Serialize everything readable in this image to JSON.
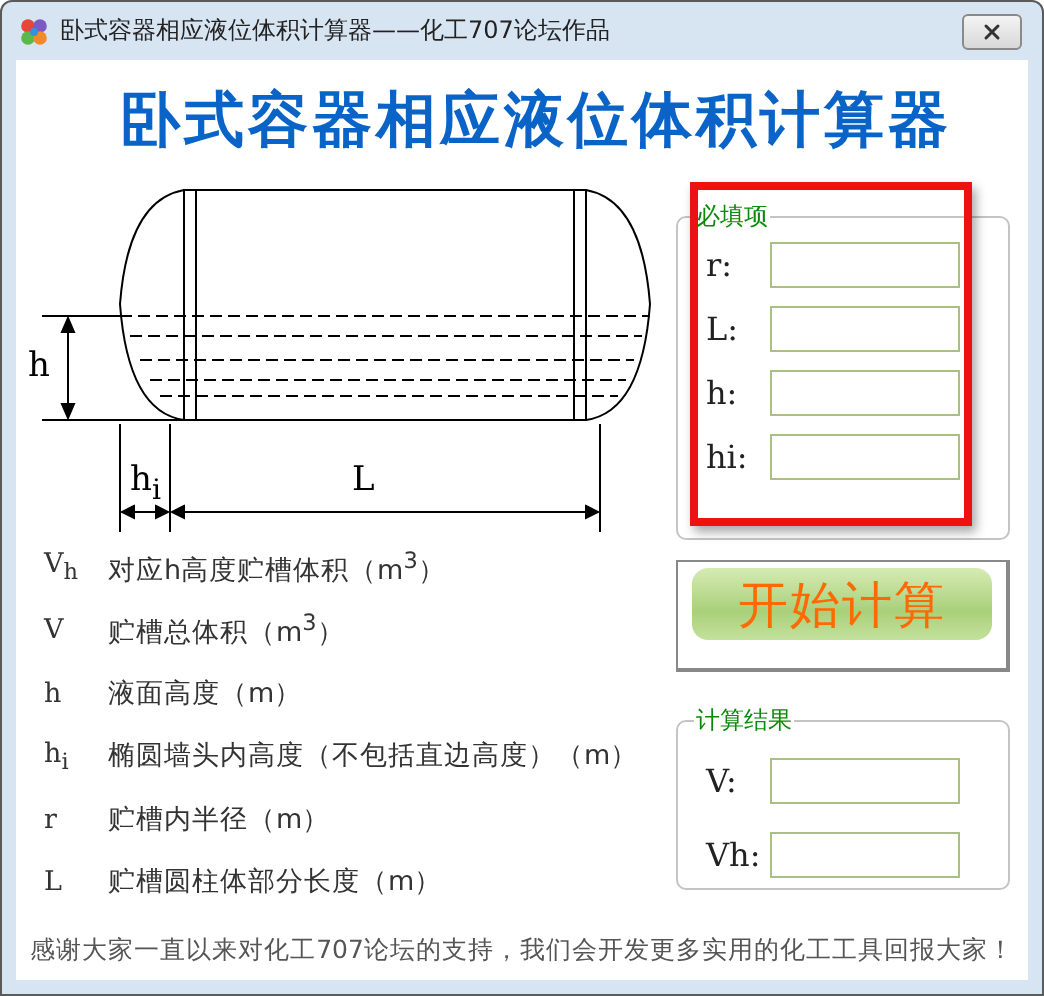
{
  "window": {
    "title": "卧式容器相应液位体积计算器——化工707论坛作品"
  },
  "heading": "卧式容器相应液位体积计算器",
  "diagram": {
    "labels": [
      {
        "kind": "h",
        "text": "h"
      },
      {
        "kind": "hi",
        "text": "h$_{i}$"
      },
      {
        "kind": "L",
        "text": "L"
      }
    ]
  },
  "legend": [
    {
      "symbol": "V$_{h}$",
      "description": "对应h高度贮槽体积（m$^{3}$）"
    },
    {
      "symbol": "V",
      "description": "贮槽总体积（m$^{3}$）"
    },
    {
      "symbol": "h",
      "description": "液面高度（m）"
    },
    {
      "symbol": "h$_{i}$",
      "description": "椭圆墙头内高度（不包括直边高度）（m）"
    },
    {
      "symbol": "r",
      "description": "贮槽内半径（m）"
    },
    {
      "symbol": "L",
      "description": "贮槽圆柱体部分长度（m）"
    }
  ],
  "required": {
    "title": "必填项",
    "highlighted": true,
    "fields": [
      {
        "label": "r:"
      },
      {
        "label": "L:"
      },
      {
        "label": "h:"
      },
      {
        "label": "hi:"
      }
    ]
  },
  "calculate_button": "开始计算",
  "results": {
    "title": "计算结果",
    "fields": [
      {
        "label": "V:"
      },
      {
        "label": "Vh:"
      }
    ]
  },
  "footer": "感谢大家一直以来对化工707论坛的支持，我们会开发更多实用的化工工具回报大家！"
}
